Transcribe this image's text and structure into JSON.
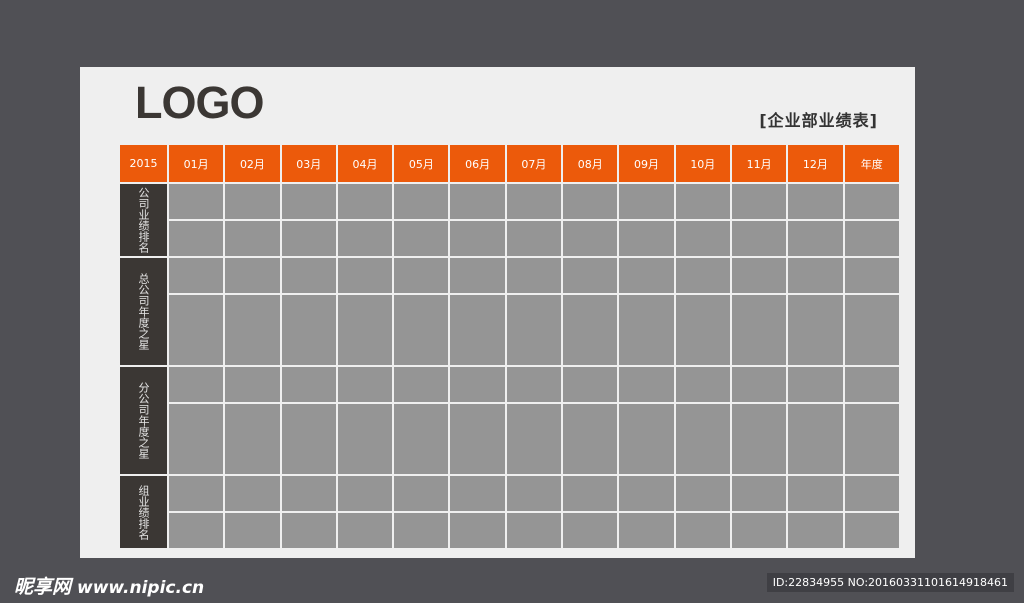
{
  "logo_text": "LOGO",
  "report_title": "[企业部业绩表]",
  "header": {
    "year": "2015",
    "months": [
      "01月",
      "02月",
      "03月",
      "04月",
      "05月",
      "06月",
      "07月",
      "08月",
      "09月",
      "10月",
      "11月",
      "12月"
    ],
    "annual": "年度"
  },
  "sections": [
    "公司业绩排名",
    "总公司年度之星",
    "分公司年度之星",
    "组业绩排名"
  ],
  "watermark": {
    "brand": "昵享网",
    "url": "www.nipic.cn",
    "id_text": "ID:22834955 NO:20160331101614918461"
  },
  "colors": {
    "accent": "#ec5a0b",
    "dark": "#3b3734",
    "cell": "#959595",
    "sheet": "#efefef",
    "background": "#505055"
  }
}
